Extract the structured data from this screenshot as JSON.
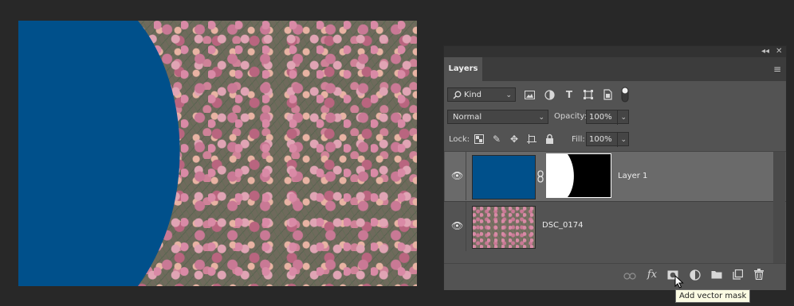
{
  "panel": {
    "tab_label": "Layers",
    "strip_icons": [
      "collapse-icon",
      "close-icon"
    ],
    "collapse_glyph": "◂◂",
    "close_glyph": "✕",
    "menu_glyph": "≡"
  },
  "filter": {
    "kind_label": "Kind",
    "icons": [
      "image-filter-icon",
      "adjustment-filter-icon",
      "type-filter-icon",
      "shape-filter-icon",
      "smart-object-filter-icon",
      "filter-toggle-icon"
    ]
  },
  "blend": {
    "mode": "Normal",
    "opacity_label": "Opacity:",
    "opacity_value": "100%"
  },
  "lock": {
    "label": "Lock:",
    "icons": [
      "lock-transparent-pixels-icon",
      "lock-image-pixels-icon",
      "lock-position-icon",
      "lock-artboard-icon",
      "lock-all-icon"
    ],
    "fill_label": "Fill:",
    "fill_value": "100%"
  },
  "layers": [
    {
      "name": "Layer 1",
      "visible": true,
      "selected": true,
      "thumb_color": "#00508b",
      "has_mask": true
    },
    {
      "name": "DSC_0174",
      "visible": true,
      "selected": false
    }
  ],
  "bottom_icons": [
    "link-layers-icon",
    "layer-style-fx-icon",
    "add-mask-icon",
    "adjustment-layer-icon",
    "new-group-icon",
    "new-layer-icon",
    "delete-layer-icon"
  ],
  "tooltip": "Add vector mask",
  "colors": {
    "shape_fill": "#00508b",
    "panel_bg": "#535353",
    "selected_row": "#6a6a6a"
  }
}
